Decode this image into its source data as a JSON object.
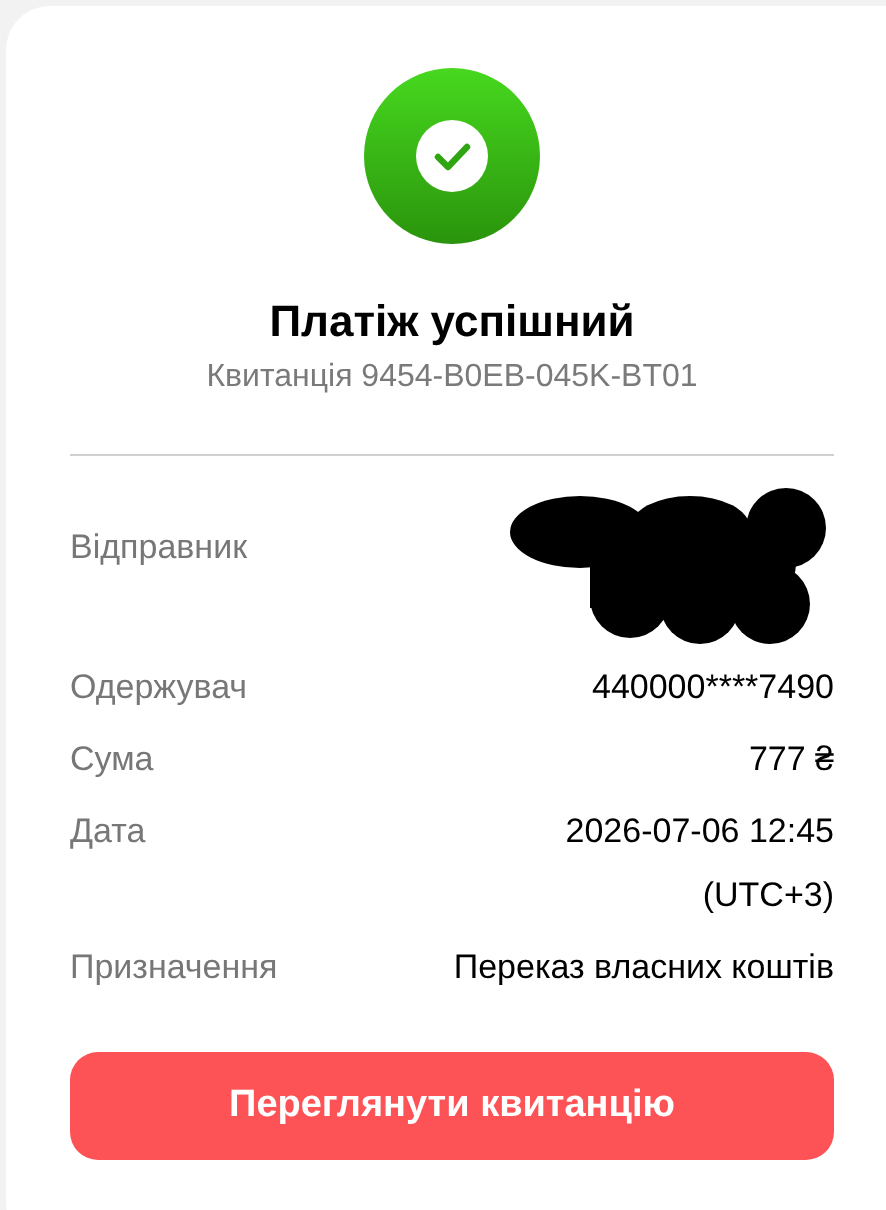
{
  "status": {
    "kind": "success",
    "title": "Платіж успішний",
    "receipt": "Квитанція 9454-B0EB-045K-BT01"
  },
  "details": [
    {
      "label": "Відправник",
      "kind": "redacted"
    },
    {
      "label": "Одержувач",
      "kind": "text",
      "value": "440000****7490"
    },
    {
      "label": "Сума",
      "kind": "text",
      "value": "777 ₴"
    },
    {
      "label": "Дата",
      "kind": "datetime",
      "value": "2026-07-06 12:45 (UTC+3)"
    },
    {
      "label": "Призначення",
      "kind": "text",
      "value": "Переказ власних коштів"
    }
  ],
  "button": {
    "label": "Переглянути квитанцію"
  }
}
